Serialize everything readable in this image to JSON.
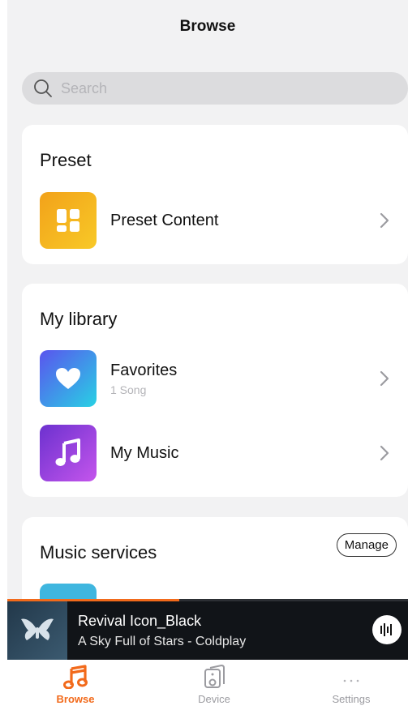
{
  "header": {
    "title": "Browse"
  },
  "search": {
    "placeholder": "Search"
  },
  "preset": {
    "title": "Preset",
    "items": [
      {
        "label": "Preset Content",
        "icon": "grid-icon"
      }
    ]
  },
  "library": {
    "title": "My library",
    "items": [
      {
        "label": "Favorites",
        "sublabel": "1 Song",
        "icon": "heart-icon"
      },
      {
        "label": "My Music",
        "sublabel": "",
        "icon": "music-note-icon"
      }
    ]
  },
  "services": {
    "title": "Music services",
    "manage_label": "Manage"
  },
  "player": {
    "title": "Revival Icon_Black",
    "subtitle": "A Sky Full of Stars - Coldplay",
    "progress": 0.43
  },
  "tabs": [
    {
      "label": "Browse",
      "icon": "music-note-icon",
      "active": true
    },
    {
      "label": "Device",
      "icon": "speaker-icon",
      "active": false
    },
    {
      "label": "Settings",
      "icon": "more-dots-icon",
      "active": false
    }
  ],
  "colors": {
    "accent": "#f26a1b",
    "background": "#f2f2f3",
    "card": "#ffffff",
    "player_bg": "#111418",
    "inactive_tab": "#9b9ba0"
  }
}
